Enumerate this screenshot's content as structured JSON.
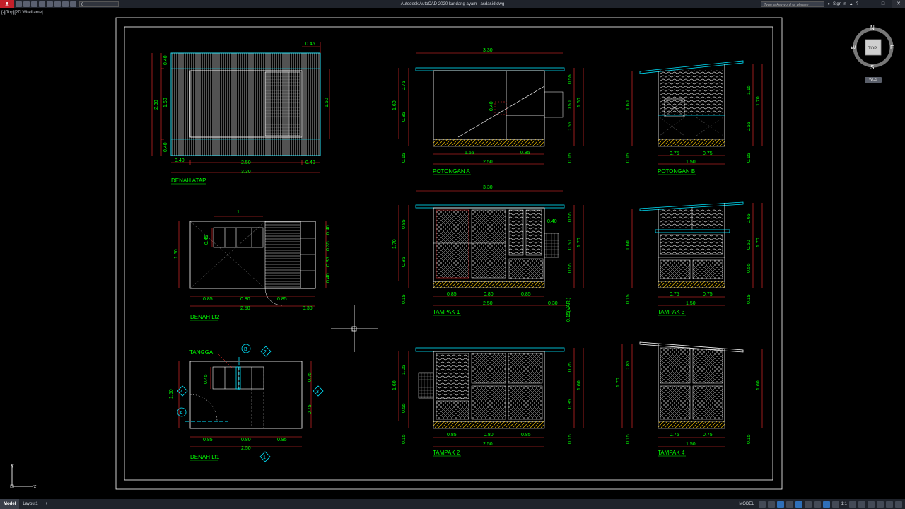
{
  "titlebar": {
    "app_logo": "A",
    "layer_value": "0",
    "title": "Autodesk AutoCAD 2020   kandang ayam - asdar.id.dwg",
    "search_placeholder": "Type a keyword or phrase",
    "sign_in": "Sign In"
  },
  "viewport": {
    "label": "[-][Top][2D Wireframe]"
  },
  "viewcube": {
    "top": "TOP",
    "n": "N",
    "s": "S",
    "e": "E",
    "w": "W",
    "wcs": "WCS"
  },
  "ucs": {
    "y": "Y",
    "x": "X"
  },
  "status": {
    "tabs": [
      "Model",
      "Layout1"
    ],
    "add_tab": "+",
    "model_label": "MODEL",
    "scale": "1:1"
  },
  "drawing": {
    "colors": {
      "line": "#ffffff",
      "dim": "#ff3030",
      "text": "#00ff00",
      "accent": "#00e5ff",
      "hatch": "#c8a000"
    },
    "denah_atap": {
      "title": "DENAH ATAP",
      "dims": [
        "0.45",
        "0.40",
        "1.50",
        "0.40",
        "2.30",
        "1.50",
        "0.40",
        "2.50",
        "0.40",
        "3.30"
      ]
    },
    "denah_lt2": {
      "title": "DENAH Lt2",
      "dims": [
        "1",
        "0.45",
        "1.50",
        "0.40",
        "0.35",
        "0.35",
        "0.40",
        "0.85",
        "0.80",
        "0.85",
        "2.50",
        "0.30"
      ]
    },
    "denah_lt1": {
      "title": "DENAH Lt1",
      "label_tangga": "TANGGA",
      "dims": [
        "0.45",
        "1.50",
        "0.75",
        "0.75",
        "0.85",
        "0.80",
        "0.85",
        "2.50"
      ],
      "markers": [
        "B",
        "2",
        "4",
        "3",
        "A",
        "1"
      ]
    },
    "potongan_a": {
      "title": "POTONGAN A",
      "dims": [
        "3.30",
        "0.75",
        "1.60",
        "0.85",
        "0.40",
        "0.55",
        "0.50",
        "1.60",
        "0.55",
        "0.15",
        "1.65",
        "0.85",
        "2.50",
        "0.15"
      ]
    },
    "potongan_b": {
      "title": "POTONGAN B",
      "dims": [
        "1.60",
        "1.15",
        "1.70",
        "0.55",
        "0.15",
        "0.75",
        "0.75",
        "1.50",
        "0.15"
      ]
    },
    "tampak_1": {
      "title": "TAMPAK 1",
      "dims": [
        "3.30",
        "0.85",
        "1.70",
        "0.85",
        "0.40",
        "0.55",
        "0.50",
        "1.70",
        "0.55",
        "0.15",
        "0.85",
        "0.80",
        "0.85",
        "2.50",
        "0.30",
        "0.15(VAR.)"
      ]
    },
    "tampak_3": {
      "title": "TAMPAK 3",
      "dims": [
        "1.60",
        "0.65",
        "0.50",
        "1.70",
        "0.55",
        "0.15",
        "0.75",
        "0.75",
        "1.50",
        "0.15"
      ]
    },
    "tampak_2": {
      "title": "TAMPAK 2",
      "dims": [
        "1.05",
        "1.60",
        "0.55",
        "0.75",
        "1.60",
        "0.85",
        "0.15",
        "0.85",
        "0.80",
        "0.85",
        "2.50",
        "0.15"
      ]
    },
    "tampak_4": {
      "title": "TAMPAK 4",
      "dims": [
        "1.70",
        "0.85",
        "1.60",
        "0.15",
        "0.75",
        "0.75",
        "1.50",
        "0.15"
      ]
    }
  }
}
